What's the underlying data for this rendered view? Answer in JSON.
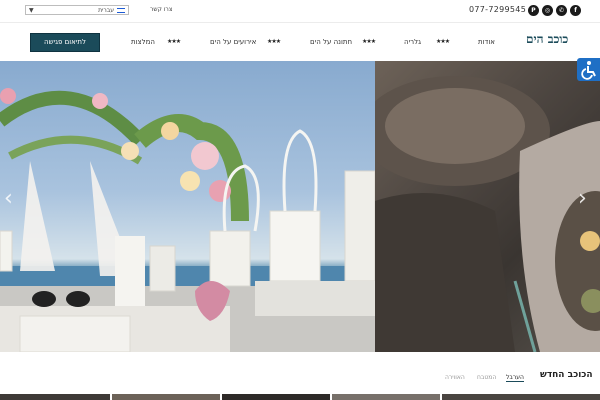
{
  "topbar": {
    "language": "עברית",
    "contact_label": "צרו קשר",
    "phone": "077-7299545",
    "social": [
      "facebook-icon",
      "phone-icon",
      "instagram-icon",
      "pinterest-icon"
    ]
  },
  "header": {
    "logo_text": "כוכב הים",
    "cta_label": "לתיאום פגישה",
    "nav": [
      {
        "label": "אודות"
      },
      {
        "label": "גלריה"
      },
      {
        "label": "חתונה על הים"
      },
      {
        "label": "אירועים על הים"
      },
      {
        "label": "המלצות"
      }
    ],
    "stars": "★★★"
  },
  "hero": {
    "slides": [
      "wedding-chuppah-by-the-sea",
      "food-platter-on-wood"
    ]
  },
  "section": {
    "title": "הכוכב החדש",
    "tabs": [
      "הערבל",
      "המטבח",
      "האווירה"
    ]
  },
  "colors": {
    "accent": "#1b4b5a",
    "accessibility": "#1f6fc5"
  }
}
